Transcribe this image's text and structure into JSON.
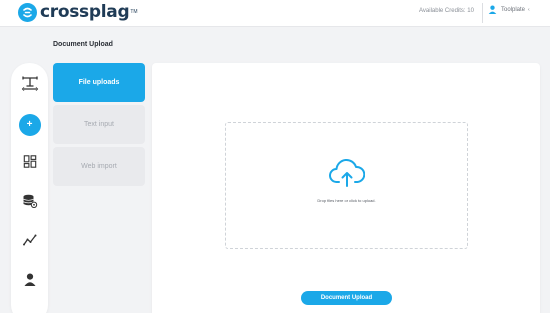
{
  "header": {
    "logo_text": "crossplag",
    "logo_mark": "TM",
    "credits_text": "Available Credits: 10",
    "user_name": "Toolplate",
    "user_caret": "‹"
  },
  "page": {
    "title": "Document Upload"
  },
  "sidebar": {
    "icons": [
      "text-tool-icon",
      "add-icon",
      "dashboard-grid-icon",
      "database-settings-icon",
      "analytics-icon",
      "user-icon"
    ],
    "add_label": "+"
  },
  "tabs": [
    {
      "label": "File uploads",
      "active": true
    },
    {
      "label": "Text input",
      "active": false
    },
    {
      "label": "Web import",
      "active": false
    }
  ],
  "upload": {
    "drop_text": "Drop files here or click to upload.",
    "button_label": "Document Upload"
  },
  "colors": {
    "accent": "#1ba8e8",
    "brand_dark": "#1f3b56",
    "background": "#f2f3f5"
  }
}
